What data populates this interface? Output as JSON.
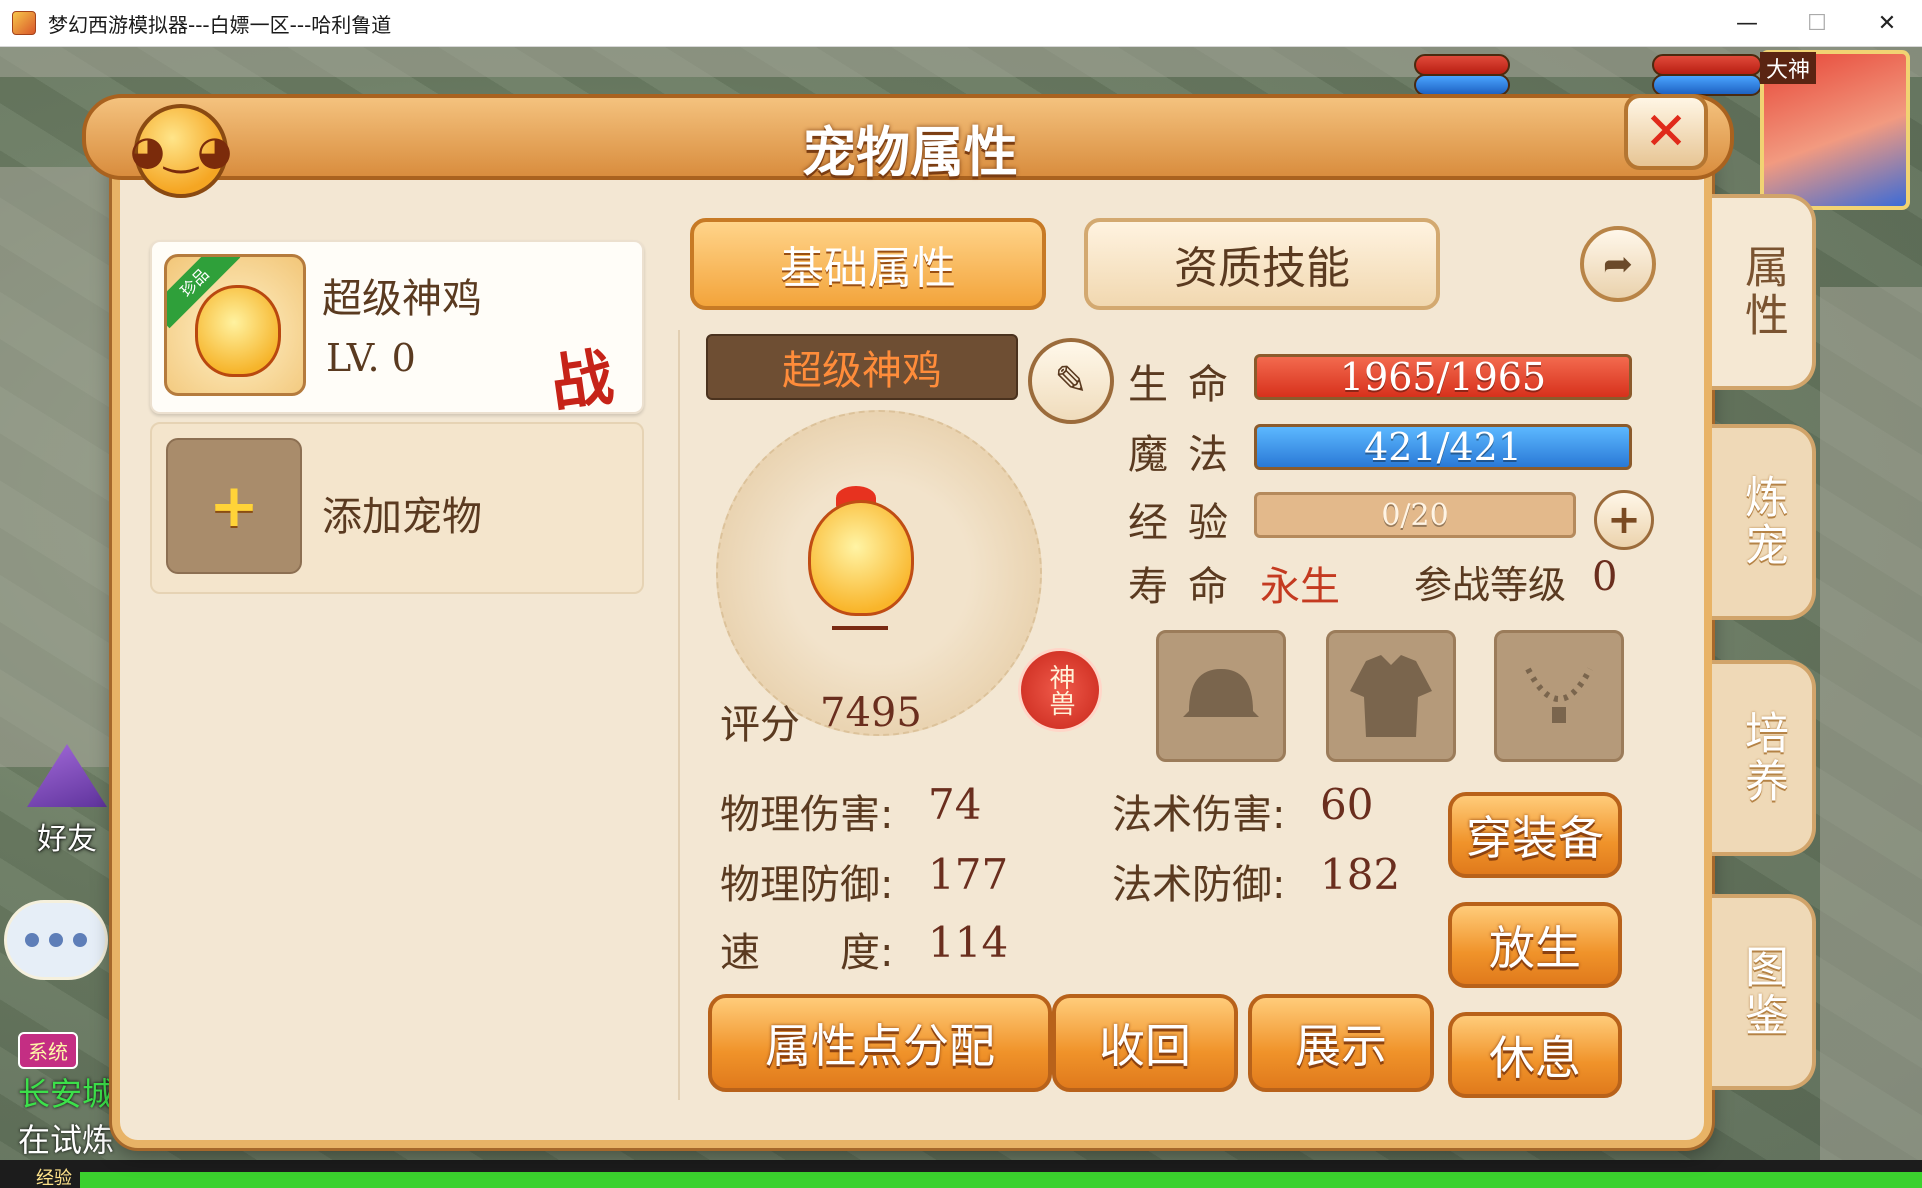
{
  "window": {
    "title": "梦幻西游模拟器---白嫖一区---哈利鲁道",
    "minimize": "—",
    "maximize": "☐",
    "close": "✕"
  },
  "scene": {
    "friend_label": "好友",
    "system_badge": "系统",
    "chat_line1": "长安城",
    "chat_line2": "在试炼",
    "exp_label": "经验",
    "avatar_tag": "大神"
  },
  "dialog": {
    "title": "宠物属性",
    "close_symbol": "✕"
  },
  "pet_list": {
    "rank_ribbon": "珍品",
    "name": "超级神鸡",
    "level": "LV. 0",
    "battle_mark": "战",
    "add_symbol": "+",
    "add_label": "添加宠物"
  },
  "tabs": {
    "basic": "基础属性",
    "skills": "资质技能"
  },
  "side_tabs": [
    "属性",
    "炼宠",
    "培养",
    "图鉴"
  ],
  "pet": {
    "name": "超级神鸡",
    "score_label": "评分",
    "score": "7495",
    "seal": "神兽"
  },
  "stats": {
    "hp_label": "生命",
    "hp": "1965/1965",
    "mp_label": "魔法",
    "mp": "421/421",
    "exp_label": "经验",
    "exp": "0/20",
    "exp_fraction": 0,
    "life_label": "寿命",
    "life": "永生",
    "battle_level_label": "参战等级",
    "battle_level": "0"
  },
  "equipment": [
    "helmet-icon",
    "armor-icon",
    "necklace-icon"
  ],
  "attributes": {
    "phys_dmg_label": "物理伤害:",
    "phys_dmg": "74",
    "mag_dmg_label": "法术伤害:",
    "mag_dmg": "60",
    "phys_def_label": "物理防御:",
    "phys_def": "177",
    "mag_def_label": "法术防御:",
    "mag_def": "182",
    "speed_label": "速　　度:",
    "speed": "114"
  },
  "buttons": {
    "equip": "穿装备",
    "release": "放生",
    "rest": "休息",
    "allocate": "属性点分配",
    "recall": "收回",
    "show": "展示"
  },
  "colors": {
    "panel": "#f3e7d3",
    "accent": "#f0932a",
    "hp_bar": "#d7311c",
    "mp_bar": "#2a79d6"
  }
}
